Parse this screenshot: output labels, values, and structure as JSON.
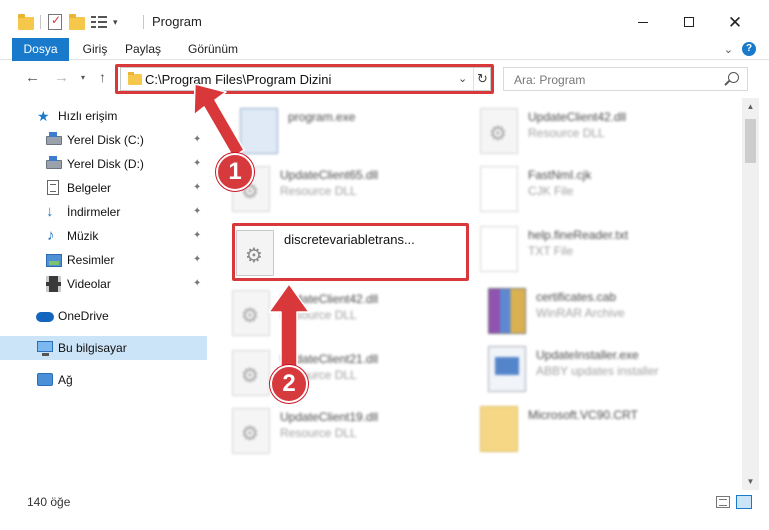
{
  "window": {
    "title": "Program",
    "quick_access_chevron": "▾",
    "minimize": "",
    "maximize": "",
    "close": "✕"
  },
  "ribbon": {
    "tabs": [
      "Dosya",
      "Giriş",
      "Paylaş",
      "Görünüm"
    ],
    "expand": "⌄",
    "help": "?"
  },
  "nav": {
    "back": "←",
    "forward": "→",
    "recent": "▾",
    "up": "↑",
    "address": "C:\\Program Files\\Program Dizini",
    "address_dropdown": "⌄",
    "refresh": "↻",
    "search_placeholder": "Ara: Program"
  },
  "sidebar": {
    "items": [
      {
        "label": "Hızlı erişim",
        "icon": "star-icon",
        "pinned": false
      },
      {
        "label": "Yerel Disk (C:)",
        "icon": "drive-icon",
        "pinned": true
      },
      {
        "label": "Yerel Disk (D:)",
        "icon": "drive-icon",
        "pinned": true
      },
      {
        "label": "Belgeler",
        "icon": "documents-icon",
        "pinned": true
      },
      {
        "label": "İndirmeler",
        "icon": "downloads-icon",
        "pinned": true
      },
      {
        "label": "Müzik",
        "icon": "music-icon",
        "pinned": true
      },
      {
        "label": "Resimler",
        "icon": "pictures-icon",
        "pinned": true
      },
      {
        "label": "Videolar",
        "icon": "videos-icon",
        "pinned": true
      },
      {
        "label": "OneDrive",
        "icon": "onedrive-icon",
        "pinned": false
      },
      {
        "label": "Bu bilgisayar",
        "icon": "this-pc-icon",
        "pinned": false,
        "selected": true
      },
      {
        "label": "Ağ",
        "icon": "network-icon",
        "pinned": false
      }
    ],
    "pin_glyph": "📌"
  },
  "files": {
    "left": [
      {
        "name": "program.exe",
        "type": "",
        "icon": "exe-icon"
      },
      {
        "name": "UpdateClient65.dll",
        "type": "Resource DLL",
        "icon": "dll-icon"
      },
      {
        "name": "discretevariabletrans...",
        "type": "",
        "icon": "dll-icon",
        "highlighted": true
      },
      {
        "name": "UpdateClient42.dll",
        "type": "Resource DLL",
        "icon": "dll-icon"
      },
      {
        "name": "UpdateClient21.dll",
        "type": "Resource DLL",
        "icon": "dll-icon"
      },
      {
        "name": "UpdateClient19.dll",
        "type": "Resource DLL",
        "icon": "dll-icon"
      }
    ],
    "right": [
      {
        "name": "UpdateClient42.dll",
        "type": "Resource DLL",
        "icon": "dll-icon"
      },
      {
        "name": "FastNmI.cjk",
        "type": "CJK File",
        "icon": "text-file-icon"
      },
      {
        "name": "help.fineReader.txt",
        "type": "TXT File",
        "icon": "text-file-icon"
      },
      {
        "name": "certificates.cab",
        "type": "WinRAR Archive",
        "icon": "winrar-icon"
      },
      {
        "name": "UpdateInstaller.exe",
        "type": "ABBY updates installer",
        "icon": "installer-icon"
      },
      {
        "name": "Microsoft.VC90.CRT",
        "type": "",
        "icon": "folder-icon"
      }
    ]
  },
  "annotations": {
    "badge_1": "1",
    "badge_2": "2",
    "color": "#d8383a"
  },
  "status": {
    "item_count": "140 öğe"
  }
}
